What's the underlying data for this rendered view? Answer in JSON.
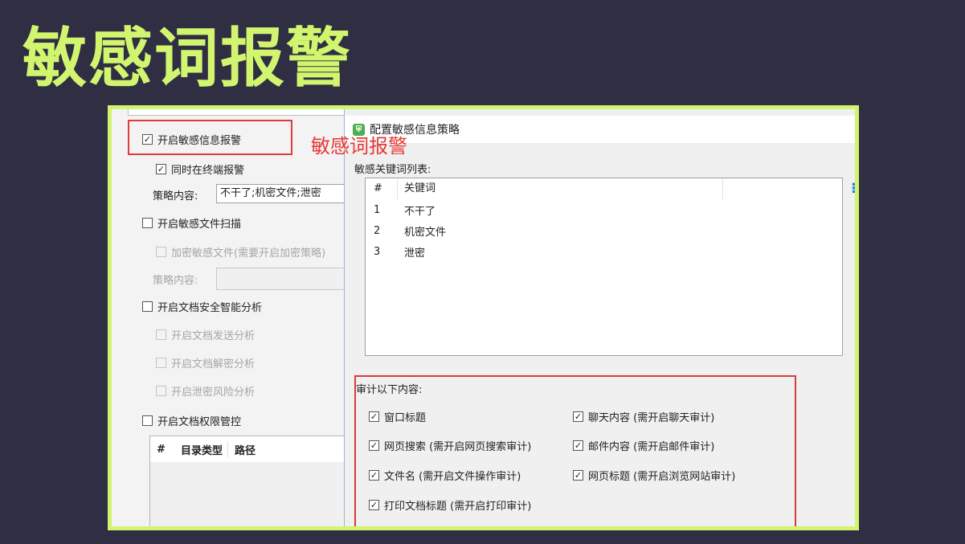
{
  "slide": {
    "title": "敏感词报警"
  },
  "left_panel": {
    "enable_sensitive_info_alarm": {
      "label": "开启敏感信息报警",
      "checked": true
    },
    "also_alarm_on_terminal": {
      "label": "同时在终端报警",
      "checked": true
    },
    "strategy_content_label": "策略内容:",
    "strategy_content_value": "不干了;机密文件;泄密",
    "enable_sensitive_file_scan": {
      "label": "开启敏感文件扫描",
      "checked": false
    },
    "encrypt_sensitive_files": {
      "label": "加密敏感文件(需要开启加密策略)",
      "checked": false
    },
    "strategy_content_label_2": "策略内容:",
    "enable_doc_security_analysis": {
      "label": "开启文档安全智能分析",
      "checked": false
    },
    "doc_send_analysis": {
      "label": "开启文档发送分析",
      "checked": false
    },
    "doc_decrypt_analysis": {
      "label": "开启文档解密分析",
      "checked": false
    },
    "leak_risk_analysis": {
      "label": "开启泄密风险分析",
      "checked": false
    },
    "doc_permission_control": {
      "label": "开启文档权限管控",
      "checked": false
    },
    "table_headers": [
      "#",
      "目录类型",
      "路径"
    ]
  },
  "dialog": {
    "title": "配置敏感信息策略",
    "app_icon": "shield-app-icon",
    "overlay_annotation": "敏感词报警",
    "keyword_list_label": "敏感关键词列表:",
    "keyword_table": {
      "headers": [
        "#",
        "关键词"
      ],
      "rows": [
        [
          "1",
          "不干了"
        ],
        [
          "2",
          "机密文件"
        ],
        [
          "3",
          "泄密"
        ]
      ]
    },
    "audit": {
      "title": "审计以下内容:",
      "items": [
        {
          "label": "窗口标题",
          "checked": true
        },
        {
          "label": "聊天内容 (需开启聊天审计)",
          "checked": true
        },
        {
          "label": "网页搜索 (需开启网页搜索审计)",
          "checked": true
        },
        {
          "label": "邮件内容 (需开启邮件审计)",
          "checked": true
        },
        {
          "label": "文件名 (需开启文件操作审计)",
          "checked": true
        },
        {
          "label": "网页标题 (需开启浏览网站审计)",
          "checked": true
        },
        {
          "label": "打印文档标题 (需开启打印审计)",
          "checked": true
        }
      ]
    }
  },
  "colors": {
    "background": "#2f2e42",
    "accent_green": "#d2f56f",
    "highlight_red": "#e03a3a"
  }
}
